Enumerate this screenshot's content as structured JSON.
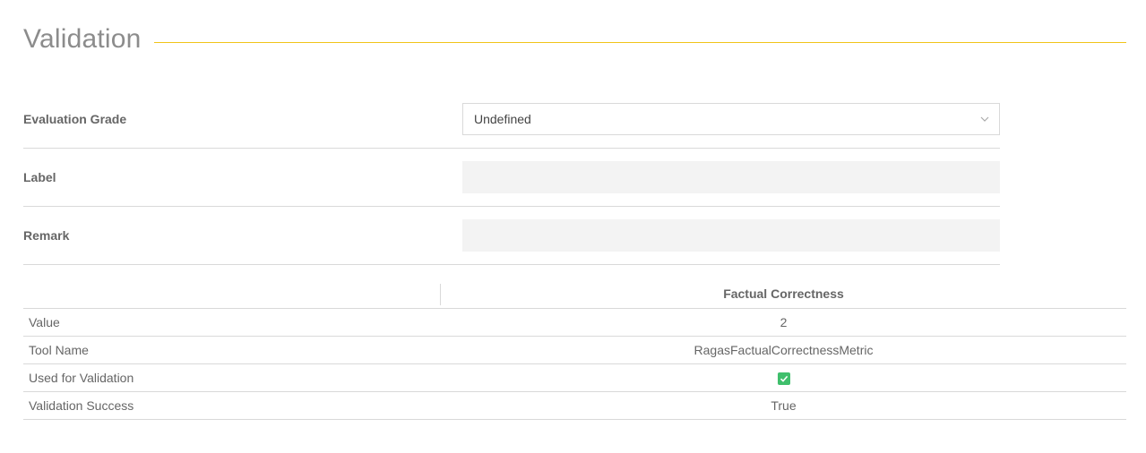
{
  "section": {
    "title": "Validation"
  },
  "form": {
    "evaluation_grade": {
      "label": "Evaluation Grade",
      "value": "Undefined"
    },
    "label_field": {
      "label": "Label",
      "value": ""
    },
    "remark_field": {
      "label": "Remark",
      "value": ""
    }
  },
  "table": {
    "column_header": "Factual Correctness",
    "rows": [
      {
        "label": "Value",
        "value": "2"
      },
      {
        "label": "Tool Name",
        "value": "RagasFactualCorrectnessMetric"
      },
      {
        "label": "Used for Validation",
        "checked": true
      },
      {
        "label": "Validation Success",
        "value": "True"
      }
    ]
  },
  "colors": {
    "accent_rule": "#f0c419",
    "checkbox_green": "#3fbf6c"
  },
  "icons": {
    "select_arrow": "chevron-down-icon",
    "checkbox": "checkbox-checked-icon"
  }
}
